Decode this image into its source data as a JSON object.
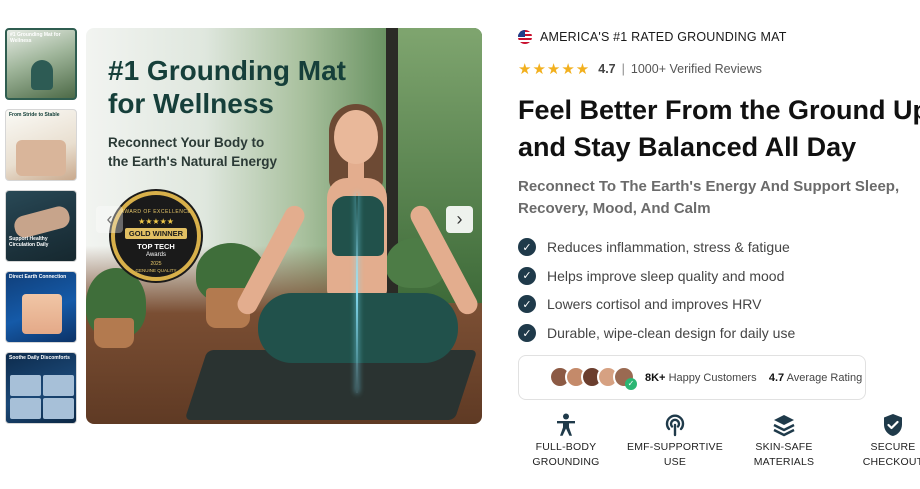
{
  "gallery": {
    "thumbnails": [
      {
        "caption": "#1 Grounding Mat for Wellness"
      },
      {
        "caption": "From Stride to Stable"
      },
      {
        "caption": "Support Healthy Circulation Daily"
      },
      {
        "caption": "Direct Earth Connection"
      },
      {
        "caption": "Soothe Daily Discomforts"
      }
    ],
    "hero": {
      "title_line1": "#1 Grounding Mat",
      "title_line2": "for Wellness",
      "subtitle_line1": "Reconnect Your Body to",
      "subtitle_line2": "the Earth's Natural Energy",
      "badge": {
        "top": "AWARD OF EXCELLENCE",
        "stars": "★★★★★",
        "gold": "GOLD WINNER",
        "tech": "TOP TECH",
        "awards": "Awards",
        "year": "2025",
        "bottom": "GENUINE QUALITY"
      }
    },
    "prev_arrow": "‹",
    "next_arrow": "›"
  },
  "product": {
    "rated_text": "AMERICA'S #1 RATED GROUNDING MAT",
    "rating": {
      "stars": "★★★★★",
      "score": "4.7",
      "separator": "|",
      "reviews": "1000+ Verified Reviews"
    },
    "headline_line1": "Feel Better From the Ground Up",
    "headline_line2": "and Stay Balanced All Day",
    "subhead_line1": "Reconnect To The Earth's Energy And Support Sleep,",
    "subhead_line2": "Recovery, Mood, And Calm",
    "benefits": [
      "Reduces inflammation, stress & fatigue",
      "Helps improve sleep quality and mood",
      "Lowers cortisol and improves HRV",
      "Durable, wipe-clean design for daily use"
    ],
    "social_proof": {
      "customers_count": "8K+",
      "customers_label": "Happy Customers",
      "average": "4.7",
      "average_label": "Average Rating"
    },
    "features": [
      {
        "line1": "FULL-BODY",
        "line2": "GROUNDING",
        "icon": "person-icon"
      },
      {
        "line1": "EMF-SUPPORTIVE",
        "line2": "USE",
        "icon": "signal-icon"
      },
      {
        "line1": "SKIN-SAFE",
        "line2": "MATERIALS",
        "icon": "layers-icon"
      },
      {
        "line1": "SECURE",
        "line2": "CHECKOUT",
        "icon": "shield-check-icon"
      }
    ]
  },
  "colors": {
    "accent_dark": "#1f3a4a",
    "star": "#f2b01e",
    "hero_title": "#163f3a"
  }
}
